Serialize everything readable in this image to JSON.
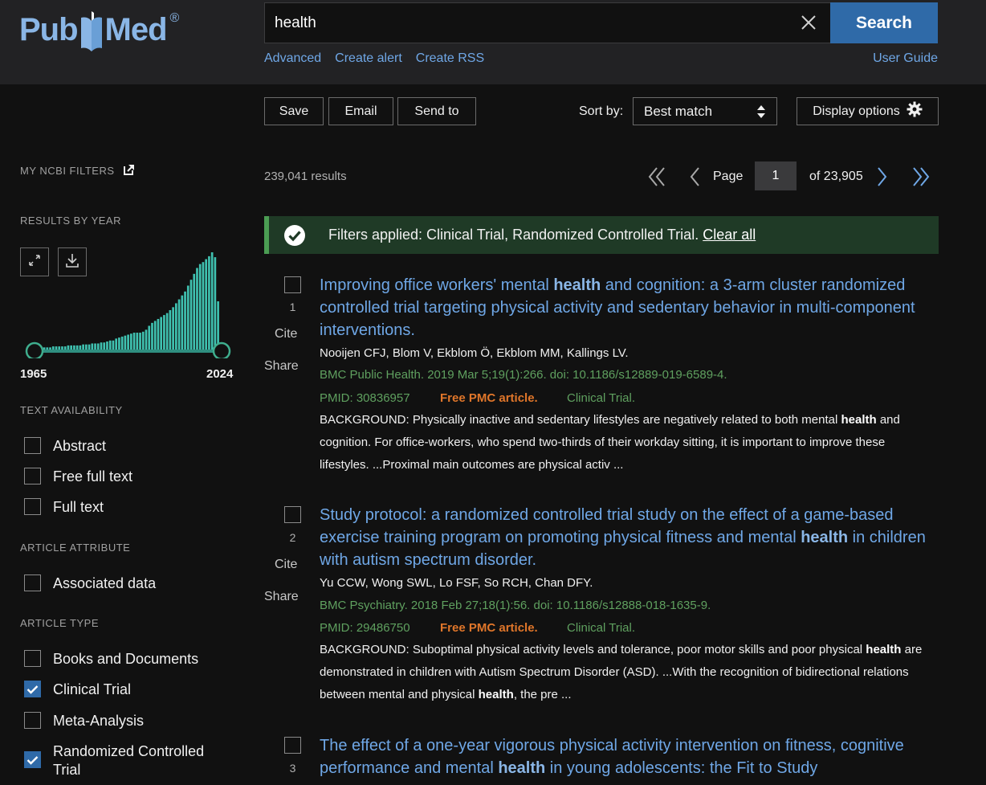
{
  "header": {
    "logo_pub": "Pub",
    "logo_med": "Med",
    "logo_reg": "®",
    "search_value": "health",
    "search_label": "Search",
    "links": [
      "Advanced",
      "Create alert",
      "Create RSS"
    ],
    "user_guide": "User Guide"
  },
  "toolbar": {
    "save": "Save",
    "email": "Email",
    "send_to": "Send to",
    "sort_label": "Sort by:",
    "sort_value": "Best match",
    "display_options": "Display options"
  },
  "sidebar": {
    "my_ncbi": "MY NCBI FILTERS",
    "results_by_year": "RESULTS BY YEAR",
    "year_start": "1965",
    "year_end": "2024",
    "text_availability": "TEXT AVAILABILITY",
    "text_filters": [
      {
        "label": "Abstract",
        "checked": false
      },
      {
        "label": "Free full text",
        "checked": false
      },
      {
        "label": "Full text",
        "checked": false
      }
    ],
    "article_attribute": "ARTICLE ATTRIBUTE",
    "attribute_filters": [
      {
        "label": "Associated data",
        "checked": false
      }
    ],
    "article_type": "ARTICLE TYPE",
    "type_filters": [
      {
        "label": "Books and Documents",
        "checked": false
      },
      {
        "label": "Clinical Trial",
        "checked": true
      },
      {
        "label": "Meta-Analysis",
        "checked": false
      },
      {
        "label": "Randomized Controlled Trial",
        "checked": true
      }
    ],
    "histogram_relative_counts": [
      0.03,
      0.03,
      0.03,
      0.03,
      0.04,
      0.04,
      0.04,
      0.04,
      0.04,
      0.05,
      0.05,
      0.05,
      0.05,
      0.05,
      0.06,
      0.06,
      0.06,
      0.07,
      0.07,
      0.07,
      0.08,
      0.08,
      0.09,
      0.1,
      0.1,
      0.12,
      0.13,
      0.14,
      0.15,
      0.16,
      0.17,
      0.18,
      0.18,
      0.18,
      0.19,
      0.21,
      0.25,
      0.28,
      0.3,
      0.32,
      0.34,
      0.36,
      0.38,
      0.41,
      0.44,
      0.48,
      0.52,
      0.56,
      0.6,
      0.66,
      0.72,
      0.78,
      0.84,
      0.88,
      0.9,
      0.93,
      0.96,
      1.0,
      0.95,
      0.5
    ]
  },
  "results": {
    "count": "239,041 results",
    "page_label": "Page",
    "page_value": "1",
    "page_of": "of 23,905",
    "filters_applied": "Filters applied: Clinical Trial, Randomized Controlled Trial.",
    "clear_all": "Clear all",
    "cite": "Cite",
    "share": "Share",
    "items": [
      {
        "num": "1",
        "title_parts": [
          "Improving office workers' mental ",
          "health",
          " and cognition: a 3-arm cluster randomized controlled trial targeting physical activity and sedentary behavior in multi-component interventions."
        ],
        "authors": "Nooijen CFJ, Blom V, Ekblom Ö, Ekblom MM, Kallings LV.",
        "journal": "BMC Public Health. 2019 Mar 5;19(1):266. doi: 10.1186/s12889-019-6589-4.",
        "pmid": "PMID: 30836957",
        "free": "Free PMC article.",
        "type": "Clinical Trial.",
        "snippet_parts": [
          "BACKGROUND: Physically inactive and sedentary lifestyles are negatively related to both mental ",
          "health",
          " and cognition. For office-workers, who spend two-thirds of their workday sitting, it is important to improve these lifestyles. ...Proximal main outcomes are physical activ ..."
        ]
      },
      {
        "num": "2",
        "title_parts": [
          "Study protocol: a randomized controlled trial study on the effect of a game-based exercise training program on promoting physical fitness and mental ",
          "health",
          " in children with autism spectrum disorder."
        ],
        "authors": "Yu CCW, Wong SWL, Lo FSF, So RCH, Chan DFY.",
        "journal": "BMC Psychiatry. 2018 Feb 27;18(1):56. doi: 10.1186/s12888-018-1635-9.",
        "pmid": "PMID: 29486750",
        "free": "Free PMC article.",
        "type": "Clinical Trial.",
        "snippet_parts": [
          "BACKGROUND: Suboptimal physical activity levels and tolerance, poor motor skills and poor physical ",
          "health",
          " are demonstrated in children with Autism Spectrum Disorder (ASD). ...With the recognition of bidirectional relations between mental and physical ",
          "health",
          ", the pre ..."
        ]
      },
      {
        "num": "3",
        "title_parts": [
          "The effect of a one-year vigorous physical activity intervention on fitness, cognitive performance and mental ",
          "health",
          " in young adolescents: the Fit to Study"
        ]
      }
    ]
  },
  "colors": {
    "header_bg": "#222224",
    "link": "#6fa7e6",
    "search_button": "#2f6aa8",
    "journal_green": "#5fa05f",
    "free_pmc_orange": "#e0762a",
    "filter_bar": "#1f3a26",
    "histogram": "#3fc1b0"
  },
  "icons": [
    "clear-x-icon",
    "sort-arrows-icon",
    "gear-icon",
    "external-link-icon",
    "expand-icon",
    "download-icon",
    "first-page-icon",
    "prev-page-icon",
    "next-page-icon",
    "last-page-icon",
    "check-circle-icon",
    "checkmark-icon"
  ]
}
